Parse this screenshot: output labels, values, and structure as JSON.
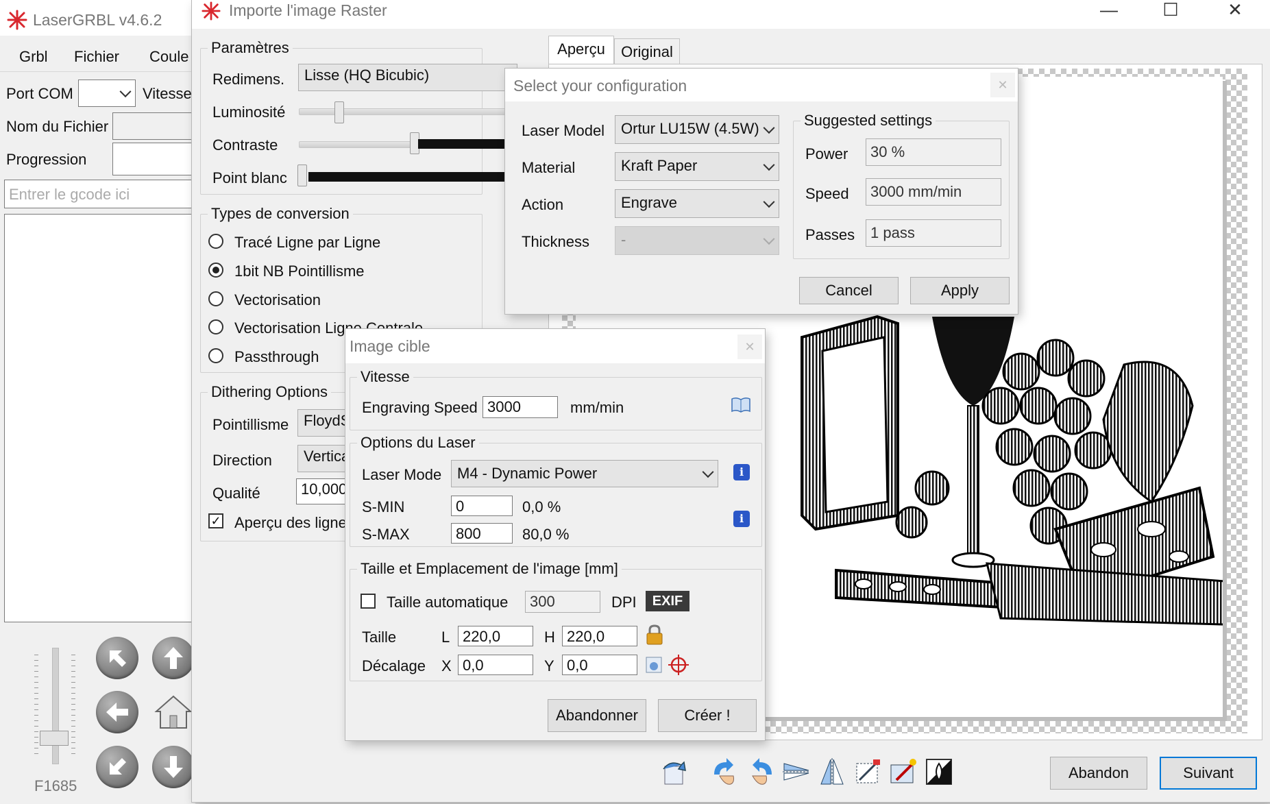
{
  "main": {
    "title": "LaserGRBL v4.6.2",
    "menu": [
      "Grbl",
      "Fichier",
      "Coule"
    ],
    "port_label": "Port COM",
    "speed_label": "Vitesse",
    "filename_label": "Nom du Fichier",
    "progress_label": "Progression",
    "gcode_placeholder": "Entrer le gcode ici",
    "f_label": "F1685"
  },
  "raster": {
    "title": "Importe l'image Raster",
    "params": {
      "legend": "Paramètres",
      "resize_label": "Redimens.",
      "resize_value": "Lisse (HQ Bicubic)",
      "brightness_label": "Luminosité",
      "contrast_label": "Contraste",
      "whitepoint_label": "Point blanc"
    },
    "conversion": {
      "legend": "Types de conversion",
      "options": [
        "Tracé Ligne par Ligne",
        "1bit NB Pointillisme",
        "Vectorisation",
        "Vectorisation Ligne Centrale",
        "Passthrough"
      ],
      "selected": "1bit NB Pointillisme"
    },
    "dithering": {
      "legend": "Dithering Options",
      "dither_label": "Pointillisme",
      "dither_value": "FloydS",
      "direction_label": "Direction",
      "direction_value": "Vertica",
      "quality_label": "Qualité",
      "quality_value": "10,000",
      "preview_lines_label": "Aperçu des lignes"
    },
    "tabs": [
      "Aperçu",
      "Original"
    ],
    "abandon_label": "Abandon",
    "next_label": "Suivant"
  },
  "config": {
    "title": "Select your configuration",
    "laser_model_label": "Laser Model",
    "laser_model_value": "Ortur LU15W (4.5W)",
    "material_label": "Material",
    "material_value": "Kraft Paper",
    "action_label": "Action",
    "action_value": "Engrave",
    "thickness_label": "Thickness",
    "thickness_value": "-",
    "suggested": {
      "legend": "Suggested settings",
      "power_label": "Power",
      "power_value": "30 %",
      "speed_label": "Speed",
      "speed_value": "3000 mm/min",
      "passes_label": "Passes",
      "passes_value": "1 pass"
    },
    "cancel_label": "Cancel",
    "apply_label": "Apply"
  },
  "target": {
    "title": "Image cible",
    "speed_legend": "Vitesse",
    "engraving_speed_label": "Engraving Speed",
    "engraving_speed_value": "3000",
    "speed_unit": "mm/min",
    "laser_legend": "Options du Laser",
    "laser_mode_label": "Laser Mode",
    "laser_mode_value": "M4 - Dynamic Power",
    "smin_label": "S-MIN",
    "smin_value": "0",
    "smin_pct": "0,0 %",
    "smax_label": "S-MAX",
    "smax_value": "800",
    "smax_pct": "80,0 %",
    "size_legend": "Taille et Emplacement de l'image [mm]",
    "auto_size_label": "Taille automatique",
    "dpi_value": "300",
    "dpi_label": "DPI",
    "exif_label": "EXIF",
    "size_label": "Taille",
    "l_label": "L",
    "l_value": "220,0",
    "h_label": "H",
    "h_value": "220,0",
    "offset_label": "Décalage",
    "x_label": "X",
    "x_value": "0,0",
    "y_label": "Y",
    "y_value": "0,0",
    "cancel_label": "Abandonner",
    "create_label": "Créer !"
  },
  "colors": {
    "accent": "#0078d7",
    "info_icon": "#2b57c8",
    "lock": "#e0a020",
    "logo": "#d9272e"
  }
}
